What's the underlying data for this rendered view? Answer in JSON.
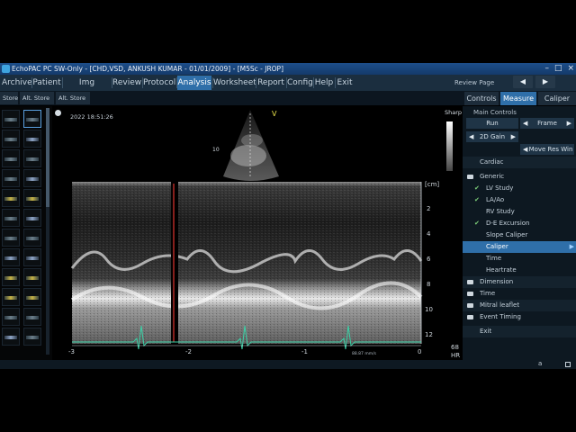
{
  "window": {
    "title": "EchoPAC PC SW-Only - [CHD,VSD, ANKUSH KUMAR - 01/01/2009] - [M5Sc - JROP]",
    "controls": [
      "–",
      "□",
      "×"
    ]
  },
  "menu": {
    "items": [
      {
        "label": "Archive"
      },
      {
        "label": "Patient"
      },
      {
        "label": "Img Browser"
      },
      {
        "label": "Review"
      },
      {
        "label": "Protocol"
      },
      {
        "label": "Analysis"
      },
      {
        "label": "Worksheet"
      },
      {
        "label": "Report"
      },
      {
        "label": "Config"
      },
      {
        "label": "Help"
      },
      {
        "label": "Exit"
      }
    ],
    "active": "Analysis"
  },
  "review": {
    "label": "Review Page",
    "prev_icon": "triangle-left-icon",
    "next_icon": "triangle-right-icon",
    "prev_glyph": "◀",
    "next_glyph": "▶"
  },
  "store": {
    "buttons": [
      {
        "label": "Store"
      },
      {
        "label": "Alt. Store 1"
      },
      {
        "label": "Alt. Store 2"
      }
    ]
  },
  "right_tabs": {
    "items": [
      {
        "label": "Controls"
      },
      {
        "label": "Measure"
      },
      {
        "label": "Caliper"
      }
    ],
    "active": "Measure"
  },
  "viewer": {
    "timestamp": "2022 18:51:26",
    "sharp_label": "Sharp",
    "v_marker": "V",
    "sector_depth_label": "10",
    "depth_unit": "[cm]",
    "depth_ticks": [
      "2",
      "4",
      "6",
      "8",
      "10",
      "12"
    ],
    "time_ticks": [
      "-3",
      "-2",
      "-1",
      "0"
    ],
    "hr_value": "68",
    "hr_label": "HR",
    "sweep_speed": "88.87 mm/s"
  },
  "panel": {
    "main_controls_header": "Main Controls",
    "run_label": "Run",
    "frame_label": "Frame",
    "gain_label": "2D Gain",
    "move_res_label": "Move Res Win",
    "cardiac_label": "Cardiac",
    "generic_label": "Generic",
    "generic_items": [
      {
        "label": "LV Study",
        "checked": true
      },
      {
        "label": "LA/Ao",
        "checked": true
      },
      {
        "label": "RV Study",
        "checked": false
      },
      {
        "label": "D-E Excursion",
        "checked": true
      },
      {
        "label": "Slope Caliper",
        "checked": false
      },
      {
        "label": "Caliper",
        "checked": false,
        "selected": true
      },
      {
        "label": "Time",
        "checked": false
      },
      {
        "label": "Heartrate",
        "checked": false
      }
    ],
    "folders": [
      {
        "label": "Dimension"
      },
      {
        "label": "Time"
      },
      {
        "label": "Mitral leaflet"
      },
      {
        "label": "Event Timing"
      }
    ],
    "exit_label": "Exit",
    "check_glyph": "✔",
    "arrow_left_glyph": "◀",
    "arrow_right_glyph": "▶"
  },
  "status": {
    "indicator": "a"
  },
  "colors": {
    "accent": "#2f6fa9",
    "ecg_trace": "#3bd0a6",
    "marker_red": "#e0332f",
    "v_marker": "#e8e14a"
  }
}
